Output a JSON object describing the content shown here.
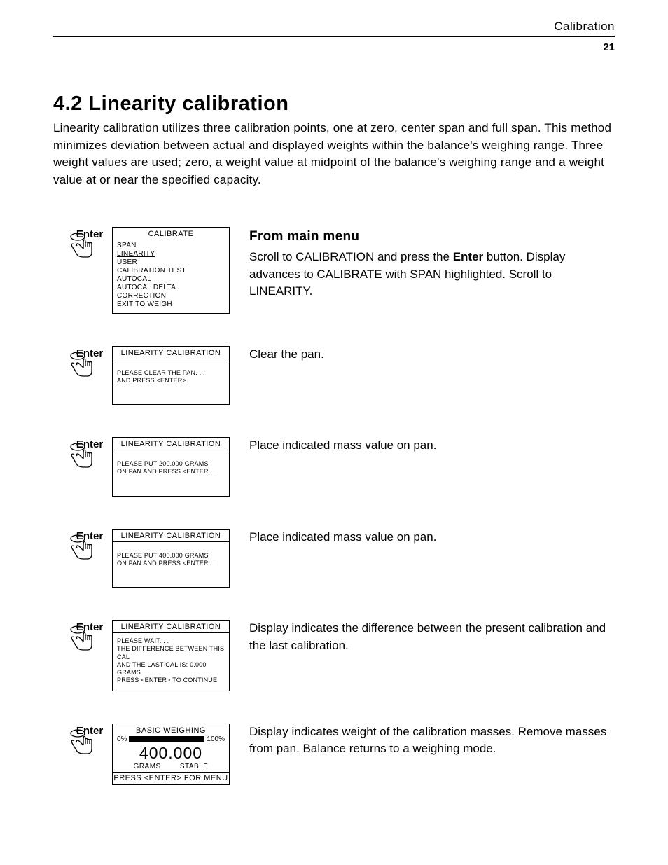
{
  "header": {
    "running": "Calibration",
    "page": "21"
  },
  "section": {
    "title": "4.2  Linearity calibration",
    "intro": "Linearity calibration utilizes three calibration points, one at zero, center span and full span. This method minimizes deviation between actual and displayed weights within the balance's weighing range. Three weight values are used; zero, a weight value at midpoint of the balance's weighing range and a weight value at or near the specified capacity."
  },
  "enter_label": "Enter",
  "steps": [
    {
      "screen": {
        "title": "CALIBRATE",
        "type": "menu",
        "items": [
          "SPAN",
          "LINEARITY",
          "USER",
          "CALIBRATION TEST",
          "AUTOCAL",
          "AUTOCAL DELTA CORRECTION",
          "EXIT TO WEIGH"
        ],
        "highlight_index": 1
      },
      "desc": {
        "heading": "From main menu",
        "text_pre": "Scroll to CALIBRATION and press the ",
        "bold": "Enter",
        "text_post": " button. Display advances to CALIBRATE with SPAN highlighted. Scroll to LINEARITY."
      }
    },
    {
      "screen": {
        "title": "LINEARITY  CALIBRATION",
        "type": "msg",
        "lines": [
          "PLEASE CLEAR THE PAN. . .",
          "AND PRESS <ENTER>."
        ]
      },
      "desc": {
        "text": "Clear the pan."
      }
    },
    {
      "screen": {
        "title": "LINEARITY  CALIBRATION",
        "type": "msg",
        "lines": [
          "PLEASE PUT 200.000 GRAMS",
          "ON PAN AND PRESS <ENTER…"
        ]
      },
      "desc": {
        "text": "Place indicated mass value on pan."
      }
    },
    {
      "screen": {
        "title": "LINEARITY  CALIBRATION",
        "type": "msg",
        "lines": [
          "PLEASE PUT 400.000 GRAMS",
          "ON PAN AND PRESS <ENTER…"
        ]
      },
      "desc": {
        "text": "Place indicated mass value on pan."
      }
    },
    {
      "screen": {
        "title": "LINEARITY  CALIBRATION",
        "type": "msg_tight",
        "lines": [
          "PLEASE WAIT. . .",
          "THE DIFFERENCE BETWEEN THIS CAL",
          "AND THE LAST CAL IS: 0.000 GRAMS",
          "PRESS <ENTER> TO CONTINUE"
        ]
      },
      "desc": {
        "text": "Display indicates the difference between the present calibration and the last calibration."
      }
    },
    {
      "screen": {
        "title": "BASIC  WEIGHING",
        "type": "weighing",
        "pct_low": "0%",
        "pct_high": "100%",
        "value": "400.000",
        "unit": "GRAMS",
        "status": "STABLE",
        "footer": "PRESS <ENTER> FOR MENU"
      },
      "desc": {
        "text": "Display indicates weight of the calibration masses. Remove masses from pan. Balance returns to a weighing mode."
      }
    }
  ]
}
